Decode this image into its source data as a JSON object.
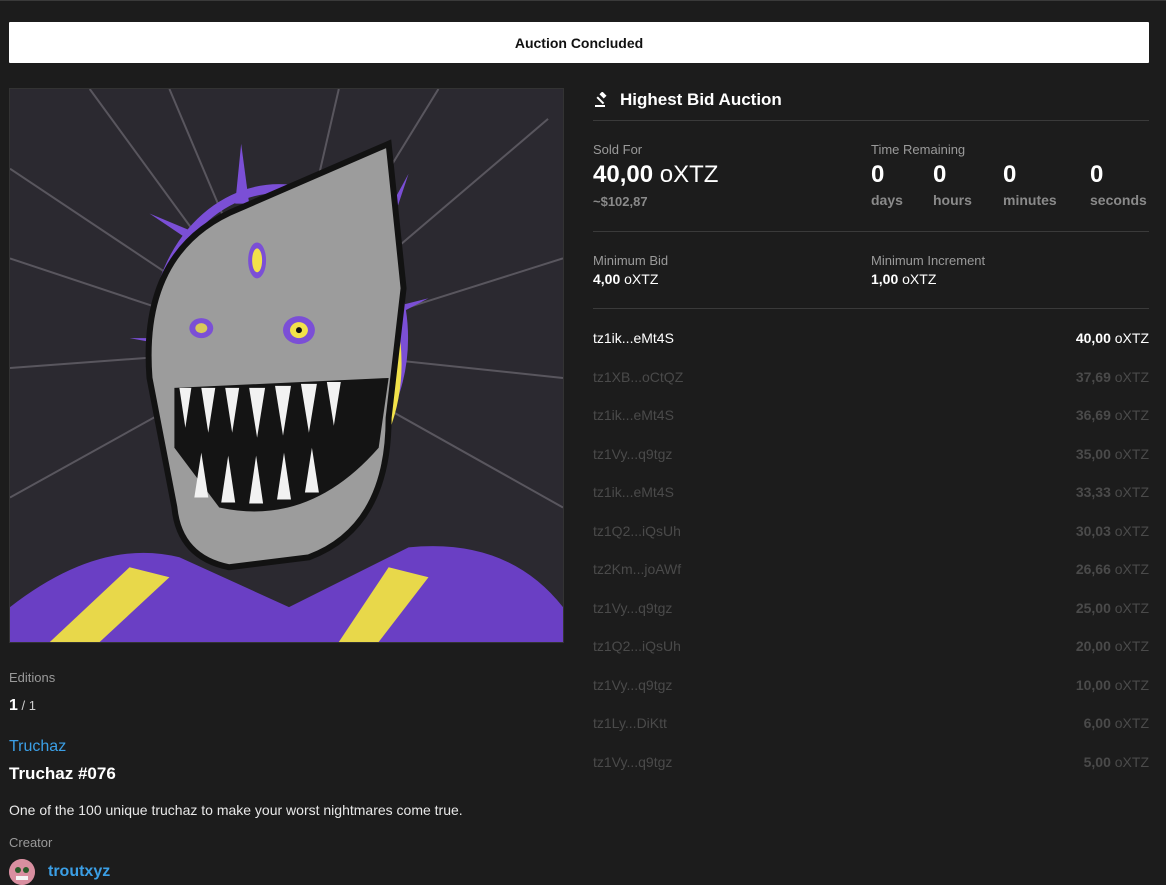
{
  "banner": {
    "status": "Auction Concluded"
  },
  "artwork": {
    "alt": "Truchaz #076"
  },
  "token": {
    "editions_label": "Editions",
    "edition_current": "1",
    "edition_total": " / 1",
    "collection": "Truchaz",
    "title": "Truchaz #076",
    "description": "One of the 100 unique truchaz to make your worst nightmares come true.",
    "creator_label": "Creator",
    "creator_name": "troutxyz"
  },
  "auction": {
    "type_label": "Highest Bid Auction",
    "sold_label": "Sold For",
    "sold_amount": "40,00",
    "sold_currency": " oXTZ",
    "sold_usd": "~$102,87",
    "time_label": "Time Remaining",
    "time": [
      {
        "value": "0",
        "unit": "days"
      },
      {
        "value": "0",
        "unit": "hours"
      },
      {
        "value": "0",
        "unit": "minutes"
      },
      {
        "value": "0",
        "unit": "seconds"
      }
    ],
    "min_bid_label": "Minimum Bid",
    "min_bid_amount": "4,00",
    "min_bid_currency": " oXTZ",
    "min_inc_label": "Minimum Increment",
    "min_inc_amount": "1,00",
    "min_inc_currency": " oXTZ"
  },
  "bids": [
    {
      "address": "tz1ik...eMt4S",
      "amount": "40,00",
      "currency": " oXTZ",
      "state": "winning"
    },
    {
      "address": "tz1XB...oCtQZ",
      "amount": "37,69",
      "currency": " oXTZ",
      "state": "outbid"
    },
    {
      "address": "tz1ik...eMt4S",
      "amount": "36,69",
      "currency": " oXTZ",
      "state": "outbid"
    },
    {
      "address": "tz1Vy...q9tgz",
      "amount": "35,00",
      "currency": " oXTZ",
      "state": "outbid"
    },
    {
      "address": "tz1ik...eMt4S",
      "amount": "33,33",
      "currency": " oXTZ",
      "state": "outbid"
    },
    {
      "address": "tz1Q2...iQsUh",
      "amount": "30,03",
      "currency": " oXTZ",
      "state": "outbid"
    },
    {
      "address": "tz2Km...joAWf",
      "amount": "26,66",
      "currency": " oXTZ",
      "state": "outbid"
    },
    {
      "address": "tz1Vy...q9tgz",
      "amount": "25,00",
      "currency": " oXTZ",
      "state": "outbid"
    },
    {
      "address": "tz1Q2...iQsUh",
      "amount": "20,00",
      "currency": " oXTZ",
      "state": "outbid"
    },
    {
      "address": "tz1Vy...q9tgz",
      "amount": "10,00",
      "currency": " oXTZ",
      "state": "outbid"
    },
    {
      "address": "tz1Ly...DiKtt",
      "amount": "6,00",
      "currency": " oXTZ",
      "state": "outbid"
    },
    {
      "address": "tz1Vy...q9tgz",
      "amount": "5,00",
      "currency": " oXTZ",
      "state": "outbid"
    }
  ],
  "colors": {
    "background": "#1c1c1c",
    "link": "#3b9fe6",
    "banner_bg": "#ffffff",
    "artwork_purple": "#7b4fd6",
    "artwork_yellow": "#f2e24a"
  },
  "icons": {
    "auction_type": "gavel-icon"
  }
}
